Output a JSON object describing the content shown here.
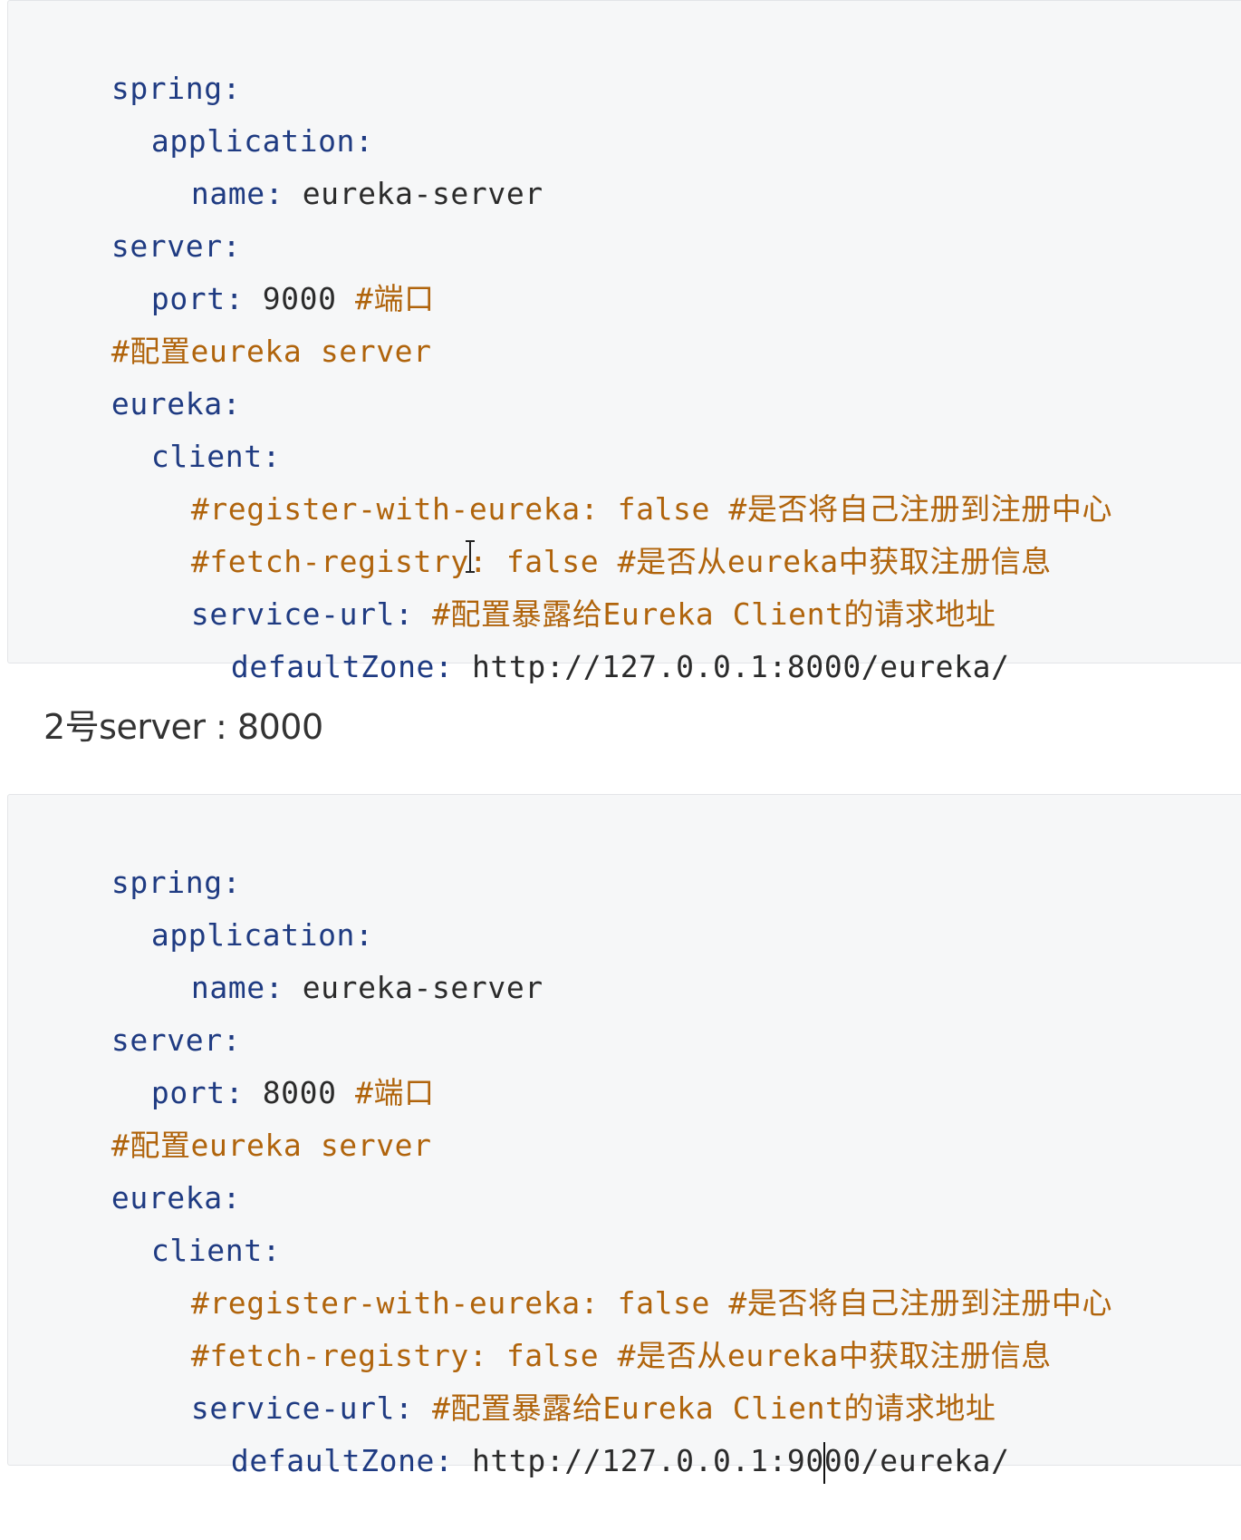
{
  "block1": {
    "spring_key": "spring:",
    "application_key": "application:",
    "name_key": "name:",
    "name_val": "eureka-server",
    "server_key": "server:",
    "port_key": "port:",
    "port_val": "9000",
    "port_comment": "#端口",
    "config_comment": "#配置eureka server",
    "eureka_key": "eureka:",
    "client_key": "client:",
    "register_comment": "#register-with-eureka: false #是否将自己注册到注册中心",
    "fetch_comment": "#fetch-registry: false #是否从eureka中获取注册信息",
    "service_url_key": "service-url:",
    "service_url_comment": "#配置暴露给Eureka Client的请求地址",
    "default_zone_key": "defaultZone:",
    "default_zone_val": "http://127.0.0.1:8000/eureka/"
  },
  "section_label": "2号server : 8000",
  "block2": {
    "spring_key": "spring:",
    "application_key": "application:",
    "name_key": "name:",
    "name_val": "eureka-server",
    "server_key": "server:",
    "port_key": "port:",
    "port_val": "8000",
    "port_comment": "#端口",
    "config_comment": "#配置eureka server",
    "eureka_key": "eureka:",
    "client_key": "client:",
    "register_comment": "#register-with-eureka: false #是否将自己注册到注册中心",
    "fetch_comment": "#fetch-registry: false #是否从eureka中获取注册信息",
    "service_url_key": "service-url:",
    "service_url_comment": "#配置暴露给Eureka Client的请求地址",
    "default_zone_key": "defaultZone:",
    "default_zone_val_before_caret": "http://127.0.0.1:90",
    "default_zone_val_after_caret": "00/eureka/"
  },
  "colors": {
    "key": "#1f3b82",
    "comment": "#b0640c",
    "value": "#2b2b2b",
    "code_bg": "#f6f7f8"
  }
}
